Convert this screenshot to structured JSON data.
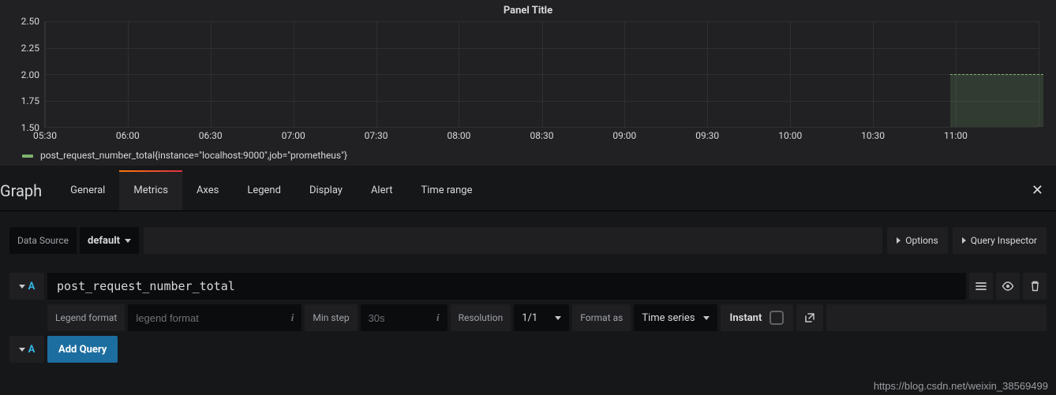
{
  "panel": {
    "title": "Panel Title"
  },
  "chart_data": {
    "type": "line",
    "title": "Panel Title",
    "xlabel": "",
    "ylabel": "",
    "ylim": [
      1.5,
      2.5
    ],
    "y_ticks": [
      "2.50",
      "2.25",
      "2.00",
      "1.75",
      "1.50"
    ],
    "x_ticks": [
      "05:30",
      "06:00",
      "06:30",
      "07:00",
      "07:30",
      "08:00",
      "08:30",
      "09:00",
      "09:30",
      "10:00",
      "10:30",
      "11:00"
    ],
    "series": [
      {
        "name": "post_request_number_total{instance=\"localhost:9000\",job=\"prometheus\"}",
        "color": "#7eb26d",
        "x": [
          "10:43",
          "11:10"
        ],
        "values": [
          2.0,
          2.0
        ]
      }
    ]
  },
  "legend": {
    "series_0": "post_request_number_total{instance=\"localhost:9000\",job=\"prometheus\"}"
  },
  "editor": {
    "section": "Graph",
    "tabs": {
      "general": "General",
      "metrics": "Metrics",
      "axes": "Axes",
      "legend": "Legend",
      "display": "Display",
      "alert": "Alert",
      "timerange": "Time range"
    },
    "datasource_label": "Data Source",
    "datasource_value": "default",
    "options_btn": "Options",
    "inspector_btn": "Query Inspector"
  },
  "query": {
    "letter": "A",
    "expr_value": "post_request_number_total",
    "legend_format_label": "Legend format",
    "legend_format_placeholder": "legend format",
    "min_step_label": "Min step",
    "min_step_placeholder": "30s",
    "resolution_label": "Resolution",
    "resolution_value": "1/1",
    "format_label": "Format as",
    "format_value": "Time series",
    "instant_label": "Instant",
    "add_query": "Add Query"
  },
  "watermark": "https://blog.csdn.net/weixin_38569499"
}
